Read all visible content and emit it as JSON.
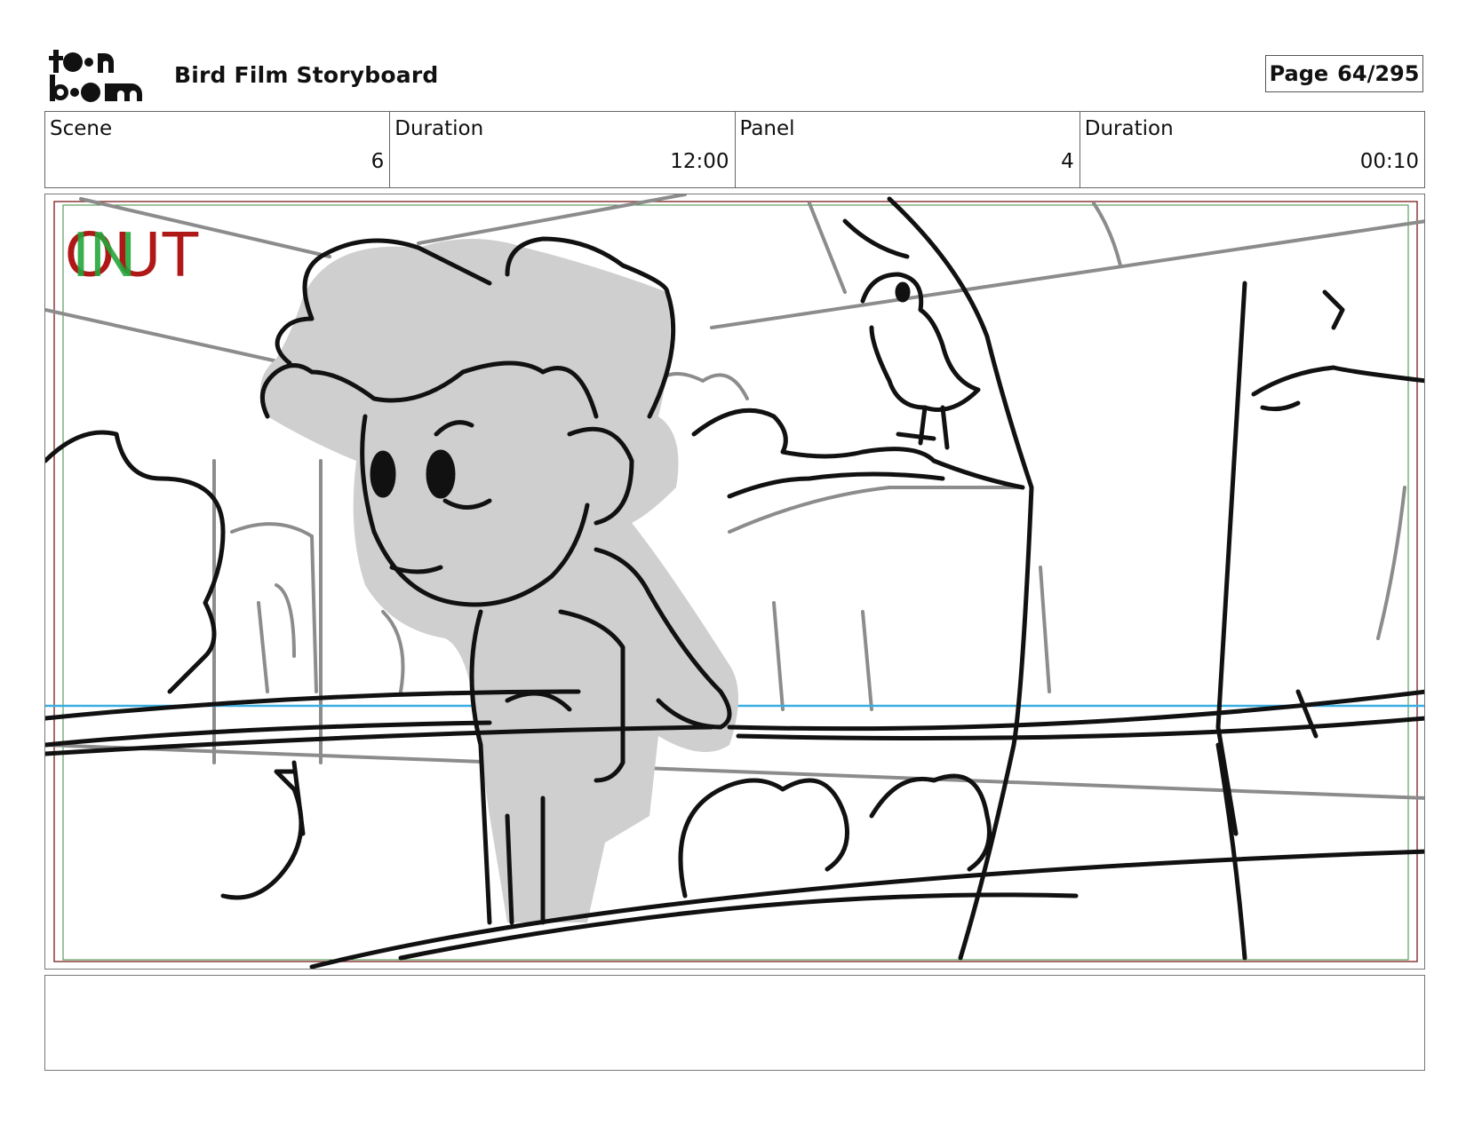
{
  "header": {
    "logo_text": "toon boom",
    "title": "Bird Film Storyboard",
    "page_label": "Page",
    "page_value": "64/295"
  },
  "info": [
    {
      "label": "Scene",
      "value": "6"
    },
    {
      "label": "Duration",
      "value": "12:00"
    },
    {
      "label": "Panel",
      "value": "4"
    },
    {
      "label": "Duration",
      "value": "00:10"
    }
  ],
  "panel": {
    "in_label": "IN",
    "out_label": "OUT"
  },
  "caption": {
    "text": ""
  },
  "colors": {
    "in_marker": "#22a83a",
    "out_marker": "#b01818",
    "horizon_line": "#3aaee0",
    "figure_fill": "#cfcfcf"
  }
}
